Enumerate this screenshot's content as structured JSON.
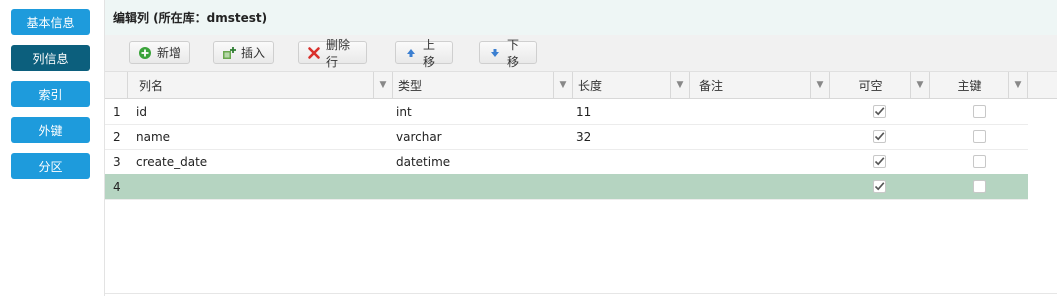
{
  "sidebar": {
    "items": [
      {
        "label": "基本信息"
      },
      {
        "label": "列信息"
      },
      {
        "label": "索引"
      },
      {
        "label": "外键"
      },
      {
        "label": "分区"
      }
    ]
  },
  "header": {
    "title": "编辑列 (所在库：dmstest)"
  },
  "toolbar": {
    "add": "新增",
    "insert": "插入",
    "delete": "删除行",
    "move_up": "上移",
    "move_down": "下移"
  },
  "grid": {
    "columns": [
      "列名",
      "类型",
      "长度",
      "备注",
      "可空",
      "主键"
    ],
    "rows": [
      {
        "num": "1",
        "name": "id",
        "type": "int",
        "length": "11",
        "comment": "",
        "nullable": true,
        "pk": false
      },
      {
        "num": "2",
        "name": "name",
        "type": "varchar",
        "length": "32",
        "comment": "",
        "nullable": true,
        "pk": false
      },
      {
        "num": "3",
        "name": "create_date",
        "type": "datetime",
        "length": "",
        "comment": "",
        "nullable": true,
        "pk": false
      },
      {
        "num": "4",
        "name": "",
        "type": "",
        "length": "",
        "comment": "",
        "nullable": true,
        "pk": false
      }
    ]
  },
  "colors": {
    "nav_blue": "#1e9bdc",
    "nav_active": "#0c5f7d",
    "selected_row": "#b5d4c1"
  }
}
